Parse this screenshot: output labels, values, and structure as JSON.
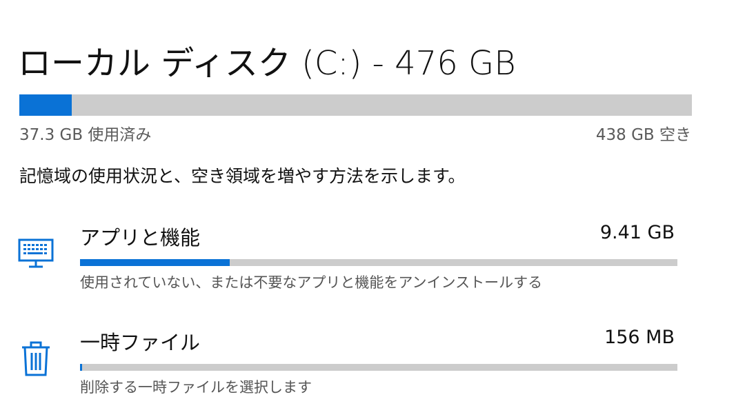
{
  "drive": {
    "title": "ローカル ディスク (C:) - 476 GB",
    "used_label": "37.3 GB 使用済み",
    "free_label": "438 GB 空き",
    "used_fraction": 0.078
  },
  "description": "記憶域の使用状況と、空き領域を増やす方法を示します。",
  "categories": [
    {
      "name": "アプリと機能",
      "size": "9.41 GB",
      "subtitle": "使用されていない、または不要なアプリと機能をアンインストールする",
      "icon": "keyboard-monitor-icon",
      "fraction": 0.25
    },
    {
      "name": "一時ファイル",
      "size": "156 MB",
      "subtitle": "削除する一時ファイルを選択します",
      "icon": "trash-icon",
      "fraction": 0.004
    }
  ],
  "colors": {
    "accent": "#0a72d6",
    "track": "#cccccc"
  }
}
